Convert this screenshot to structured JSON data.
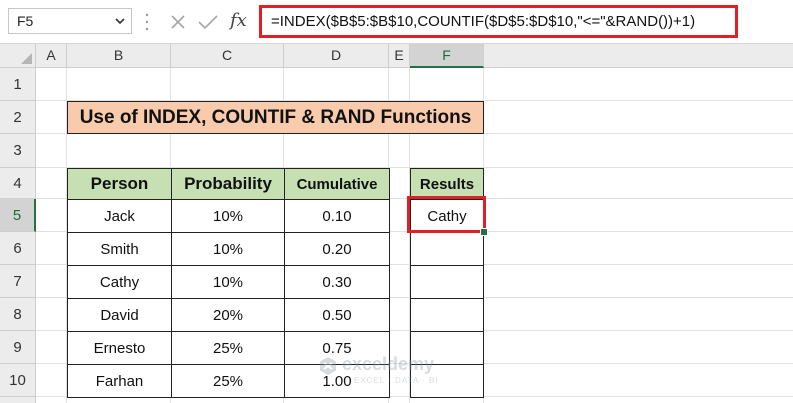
{
  "name_box": {
    "value": "F5"
  },
  "formula_bar": {
    "formula": "=INDEX($B$5:$B$10,COUNTIF($D$5:$D$10,\"<=\"&RAND())+1)",
    "cancel_icon": "x-icon",
    "enter_icon": "check-icon",
    "function_icon": "fx-icon",
    "fx_label": "fx"
  },
  "columns": [
    "A",
    "B",
    "C",
    "D",
    "E",
    "F"
  ],
  "rows": [
    "1",
    "2",
    "3",
    "4",
    "5",
    "6",
    "7",
    "8",
    "9",
    "10"
  ],
  "active_cell": {
    "column": "F",
    "row": "5"
  },
  "sheet": {
    "title": "Use of INDEX, COUNTIF & RAND Functions",
    "table": {
      "headers": [
        "Person",
        "Probability",
        "Cumulative"
      ],
      "rows": [
        [
          "Jack",
          "10%",
          "0.10"
        ],
        [
          "Smith",
          "10%",
          "0.20"
        ],
        [
          "Cathy",
          "10%",
          "0.30"
        ],
        [
          "David",
          "20%",
          "0.50"
        ],
        [
          "Ernesto",
          "25%",
          "0.75"
        ],
        [
          "Farhan",
          "25%",
          "1.00"
        ]
      ]
    },
    "results": {
      "header": "Results",
      "values": [
        "Cathy",
        "",
        "",
        "",
        "",
        ""
      ]
    }
  },
  "watermark": {
    "name": "exceldemy",
    "tagline": "EXCEL · DATA · BI"
  },
  "colors": {
    "title_fill": "#f8cbad",
    "header_fill": "#c6e0b4",
    "highlight_border": "#e01f26",
    "excel_green": "#217346"
  }
}
